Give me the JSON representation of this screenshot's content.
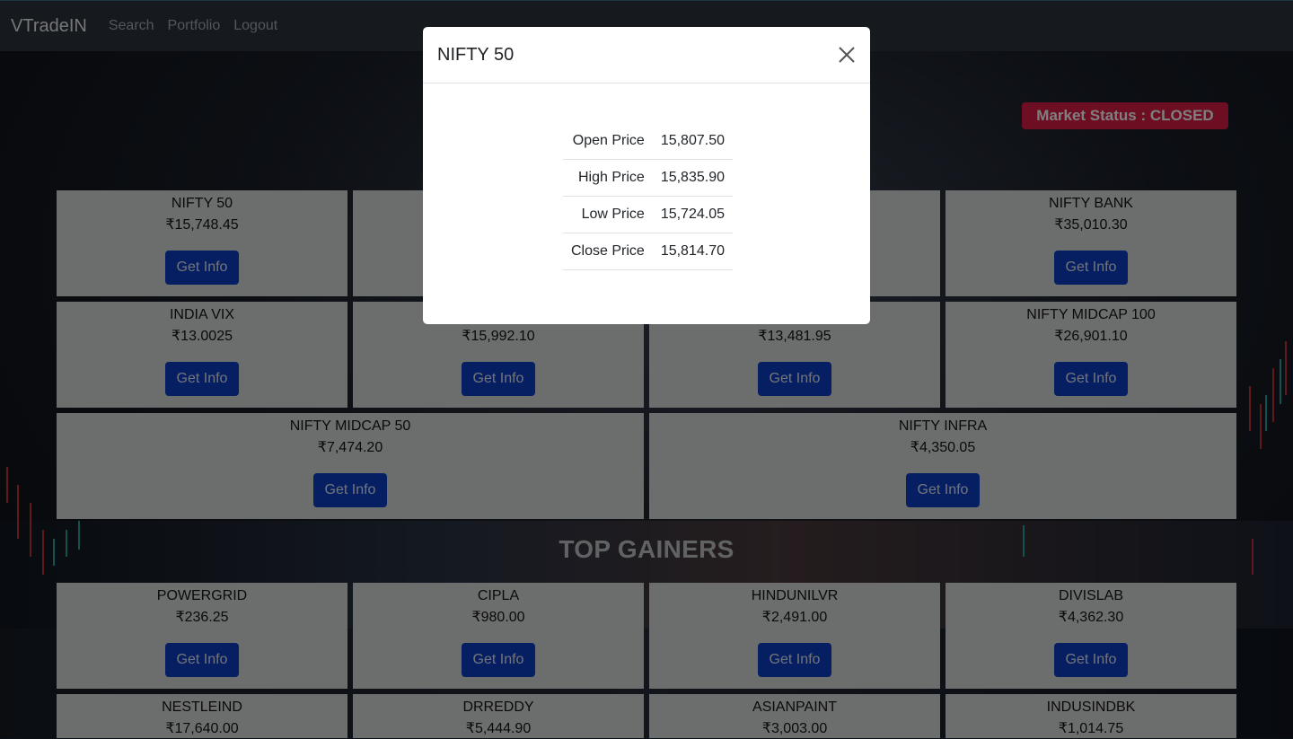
{
  "navbar": {
    "brand": "VTradeIN",
    "links": [
      "Search",
      "Portfolio",
      "Logout"
    ]
  },
  "market_status": "Market Status : CLOSED",
  "indices": [
    {
      "name": "NIFTY 50",
      "price": "₹15,748.45",
      "button": "Get Info"
    },
    {
      "name": "",
      "price": "",
      "button": ""
    },
    {
      "name": "",
      "price": "",
      "button": ""
    },
    {
      "name": "NIFTY BANK",
      "price": "₹35,010.30",
      "button": "Get Info"
    },
    {
      "name": "INDIA VIX",
      "price": "₹13.0025",
      "button": "Get Info"
    },
    {
      "name": "",
      "price": "₹15,992.10",
      "button": "Get Info"
    },
    {
      "name": "",
      "price": "₹13,481.95",
      "button": "Get Info"
    },
    {
      "name": "NIFTY MIDCAP 100",
      "price": "₹26,901.10",
      "button": "Get Info"
    },
    {
      "name": "NIFTY MIDCAP 50",
      "price": "₹7,474.20",
      "button": "Get Info"
    },
    {
      "name": "NIFTY INFRA",
      "price": "₹4,350.05",
      "button": "Get Info"
    }
  ],
  "top_gainers_title": "TOP GAINERS",
  "top_gainers": [
    {
      "name": "POWERGRID",
      "price": "₹236.25",
      "button": "Get Info"
    },
    {
      "name": "CIPLA",
      "price": "₹980.00",
      "button": "Get Info"
    },
    {
      "name": "HINDUNILVR",
      "price": "₹2,491.00",
      "button": "Get Info"
    },
    {
      "name": "DIVISLAB",
      "price": "₹4,362.30",
      "button": "Get Info"
    },
    {
      "name": "NESTLEIND",
      "price": "₹17,640.00",
      "button": "Get Info"
    },
    {
      "name": "DRREDDY",
      "price": "₹5,444.90",
      "button": "Get Info"
    },
    {
      "name": "ASIANPAINT",
      "price": "₹3,003.00",
      "button": "Get Info"
    },
    {
      "name": "INDUSINDBK",
      "price": "₹1,014.75",
      "button": "Get Info"
    }
  ],
  "modal": {
    "title": "NIFTY 50",
    "rows": [
      {
        "label": "Open Price",
        "value": "15,807.50"
      },
      {
        "label": "High Price",
        "value": "15,835.90"
      },
      {
        "label": "Low Price",
        "value": "15,724.05"
      },
      {
        "label": "Close Price",
        "value": "15,814.70"
      }
    ]
  },
  "colors": {
    "navbar_bg": "#2d343d",
    "status_badge": "#dc1d45",
    "button": "#0d3fc4",
    "card_bg": "#d9dadb"
  }
}
